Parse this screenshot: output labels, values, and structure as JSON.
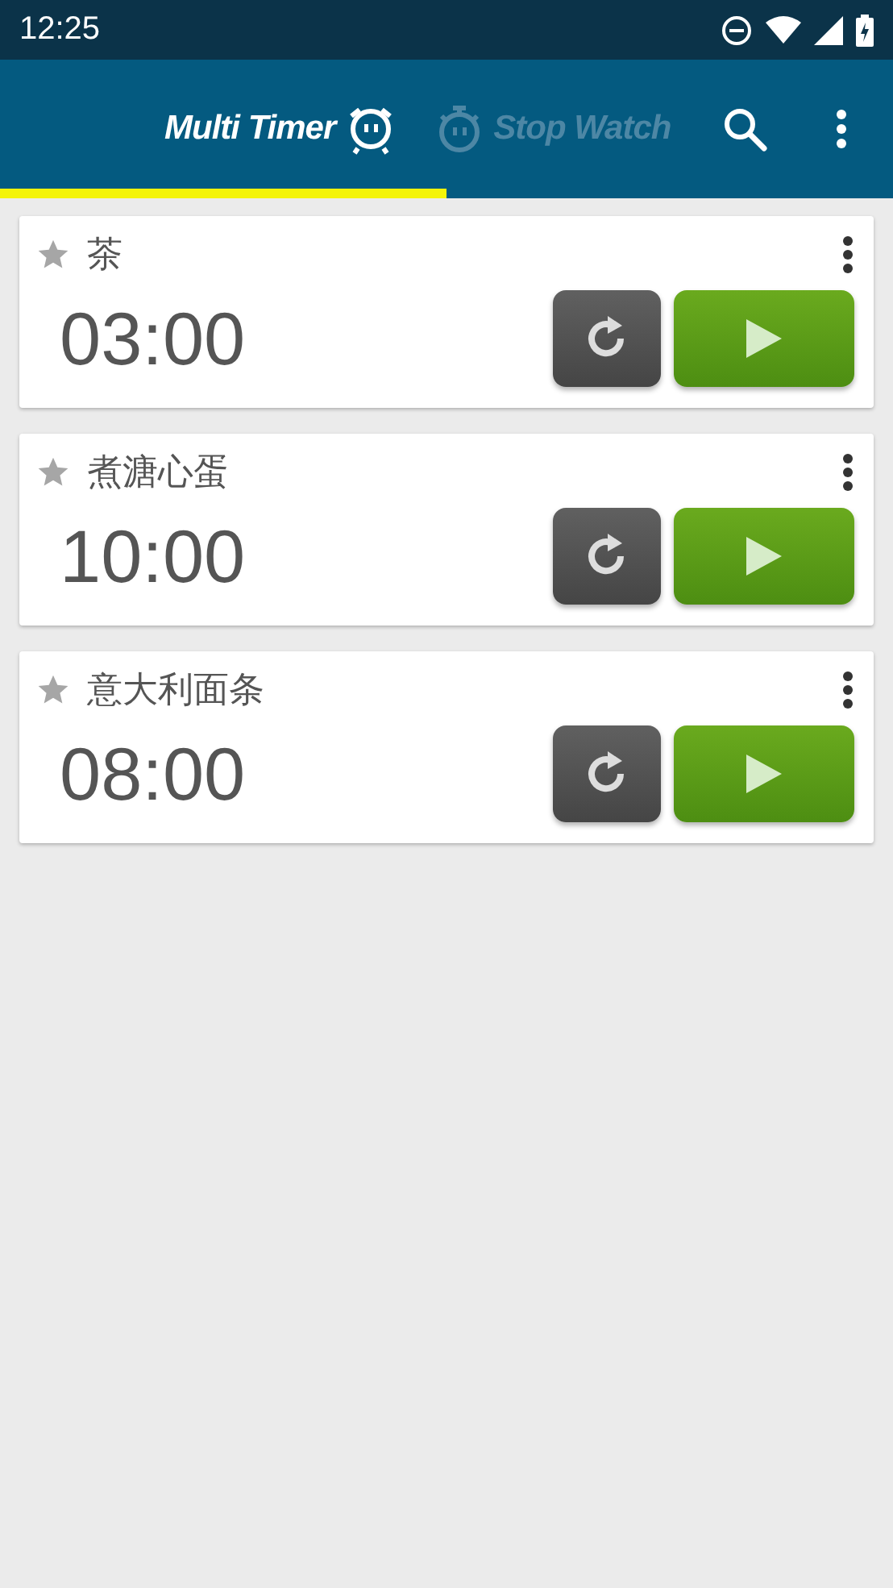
{
  "status_bar": {
    "time": "12:25"
  },
  "tabs": [
    {
      "label": "Multi Timer",
      "selected": true
    },
    {
      "label": "Stop Watch",
      "selected": false
    }
  ],
  "timers": [
    {
      "name": "茶",
      "time": "03:00",
      "starred": false
    },
    {
      "name": "煮溏心蛋",
      "time": "10:00",
      "starred": false
    },
    {
      "name": "意大利面条",
      "time": "08:00",
      "starred": false
    }
  ]
}
